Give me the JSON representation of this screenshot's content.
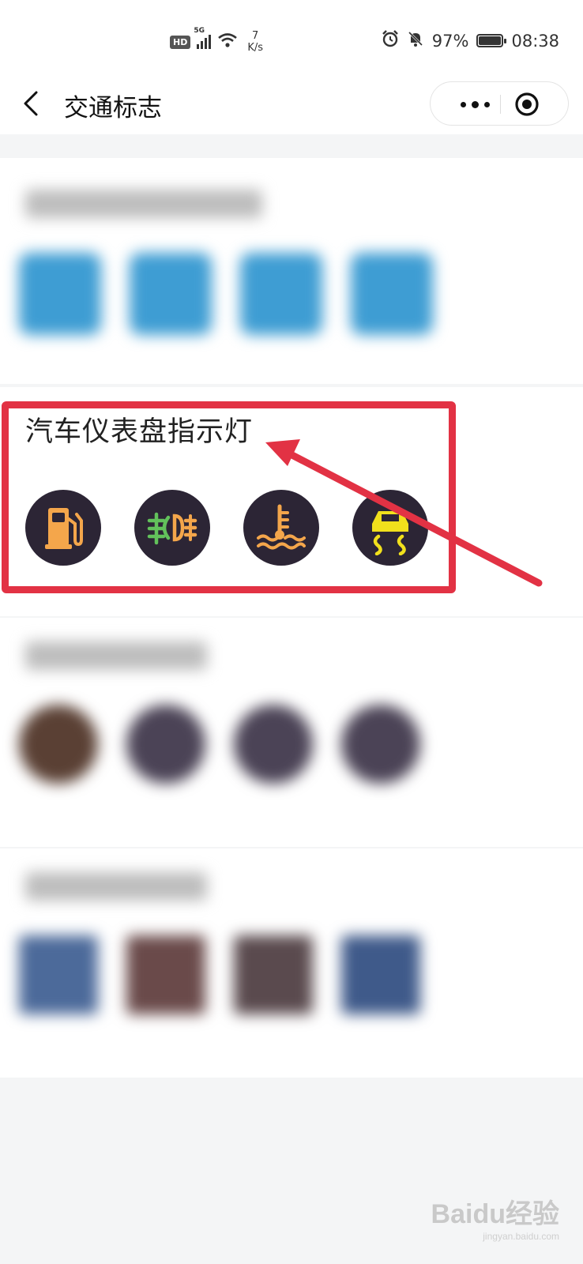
{
  "status_bar": {
    "hd_badge": "HD",
    "network": "5G",
    "speed_value": "7",
    "speed_unit": "K/s",
    "battery_percent": "97%",
    "battery_level": 0.97,
    "time": "08:38"
  },
  "nav": {
    "title": "交通标志",
    "icons": [
      "back-arrow-icon",
      "more-dots-icon",
      "close-target-icon"
    ]
  },
  "sections": [
    {
      "title": "汽车仪表盘指示灯",
      "icons": [
        "fuel-warning-icon",
        "fog-light-icon",
        "coolant-temperature-icon",
        "traction-control-icon"
      ],
      "colors": {
        "circle": "#2c2535",
        "fuel": "#f4a64b",
        "fog_green": "#62c15b",
        "fog_orange": "#f4a64b",
        "coolant": "#f4a64b",
        "traction": "#f1e01c"
      }
    }
  ],
  "annotation": {
    "highlight_color": "#e23244"
  },
  "watermark": {
    "brand": "Baidu经验",
    "url": "jingyan.baidu.com"
  }
}
